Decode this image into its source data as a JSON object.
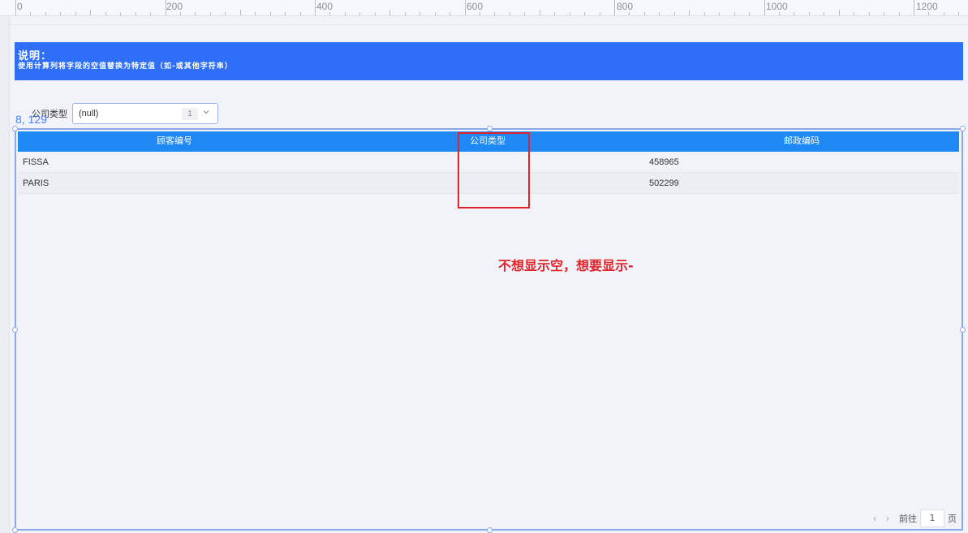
{
  "ruler": {
    "labels": [
      "0",
      "200",
      "400",
      "600",
      "800",
      "1000",
      "1200"
    ]
  },
  "banner": {
    "title": "说明：",
    "text": "使用计算列将字段的空值替换为特定值（如-或其他字符串）",
    "color": "#2f6ef7"
  },
  "filter": {
    "label": "公司类型",
    "value": "(null)",
    "count": "1",
    "arrow_icon": "chevron-down-icon"
  },
  "selection": {
    "coords": "8, 129"
  },
  "table": {
    "header_color": "#1e88f5",
    "columns": [
      "顾客编号",
      "公司类型",
      "邮政编码"
    ],
    "rows": [
      [
        "FISSA",
        "",
        "458965"
      ],
      [
        "PARIS",
        "",
        "502299"
      ]
    ]
  },
  "annotation": {
    "text": "不想显示空，想要显示-",
    "color": "#e0242a"
  },
  "pager": {
    "prev_icon": "chevron-left-icon",
    "next_icon": "chevron-right-icon",
    "goto_label": "前往",
    "page": "1",
    "page_suffix": "页"
  }
}
